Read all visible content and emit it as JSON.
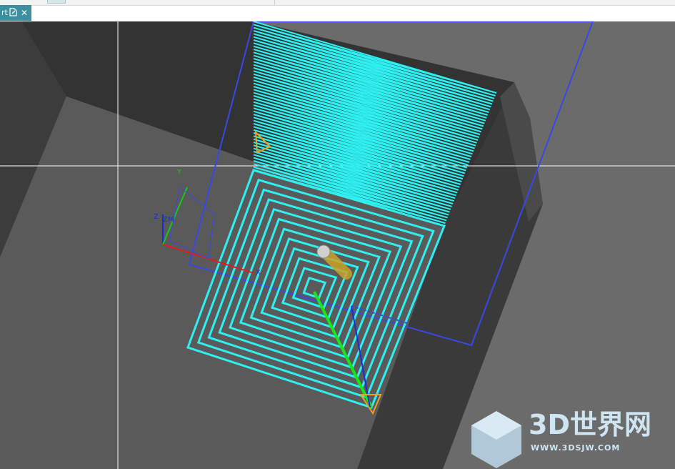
{
  "tab": {
    "label": "rt",
    "close_glyph": "✕",
    "edit_icon": "edit-document-icon"
  },
  "view": {
    "triad": {
      "x": "X",
      "y": "Y",
      "z": "Z"
    },
    "mcs_label": "ZM"
  },
  "watermark": {
    "brand": "3D世界网",
    "url": "WWW.3DSJW.COM"
  },
  "colors": {
    "toolpath": "#2ff0f0",
    "boundary": "#3a47e8",
    "engage": "#19e619",
    "tool": "#c9a227",
    "background": "#6b6b6b",
    "wall": "#353535",
    "floor": "#595959"
  }
}
